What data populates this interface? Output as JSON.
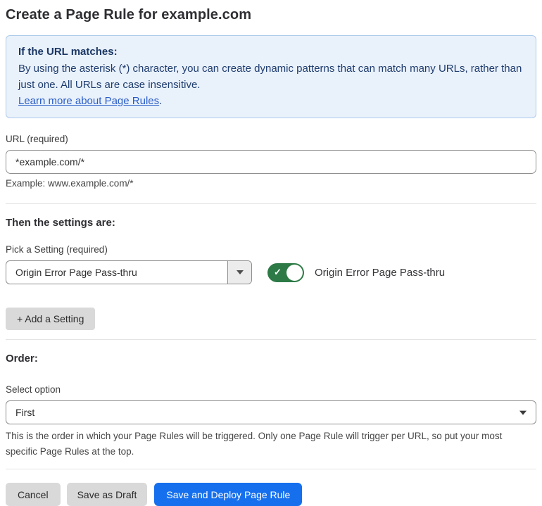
{
  "page": {
    "title": "Create a Page Rule for example.com"
  },
  "info_box": {
    "heading": "If the URL matches:",
    "body": "By using the asterisk (*) character, you can create dynamic patterns that can match many URLs, rather than just one. All URLs are case insensitive.",
    "link_label": "Learn more about Page Rules",
    "link_suffix": "."
  },
  "url_field": {
    "label": "URL (required)",
    "value": "*example.com/*",
    "example": "Example: www.example.com/*"
  },
  "settings": {
    "heading": "Then the settings are:",
    "picker_label": "Pick a Setting (required)",
    "selected_setting": "Origin Error Page Pass-thru",
    "toggle": {
      "state": "on",
      "check_glyph": "✓",
      "label": "Origin Error Page Pass-thru"
    },
    "add_button_label": "+ Add a Setting"
  },
  "order": {
    "heading": "Order:",
    "select_label": "Select option",
    "selected_option": "First",
    "help_text": "This is the order in which your Page Rules will be triggered. Only one Page Rule will trigger per URL, so put your most specific Page Rules at the top."
  },
  "footer": {
    "cancel_label": "Cancel",
    "save_draft_label": "Save as Draft",
    "save_deploy_label": "Save and Deploy Page Rule"
  },
  "colors": {
    "accent_blue": "#1670ee",
    "info_background": "#e9f1fb",
    "info_border": "#aecbea",
    "info_text": "#1e3c6e",
    "link_blue": "#2a5dc6",
    "toggle_green": "#2d7a46",
    "button_gray": "#d9d9d9"
  }
}
